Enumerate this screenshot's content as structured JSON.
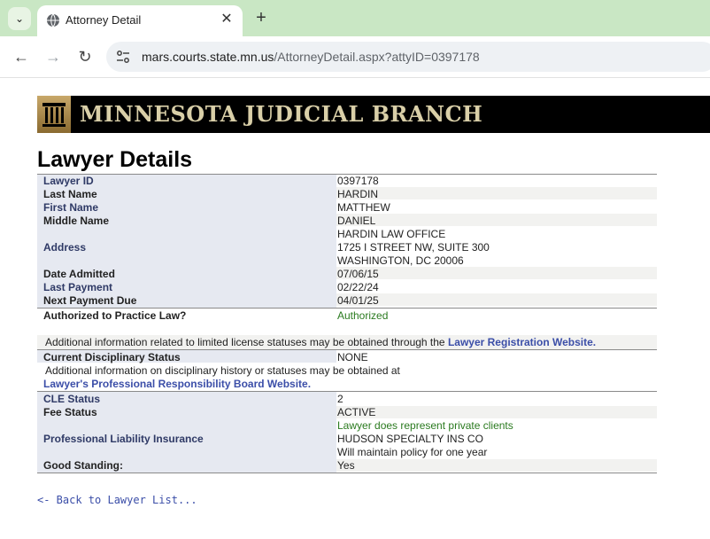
{
  "browser": {
    "tab_title": "Attorney Detail",
    "url_host": "mars.courts.state.mn.us",
    "url_path": "/AttorneyDetail.aspx?attyID=0397178"
  },
  "banner": {
    "title": "MINNESOTA JUDICIAL BRANCH"
  },
  "page_title": "Lawyer Details",
  "details": {
    "lawyer_id_label": "Lawyer ID",
    "lawyer_id": "0397178",
    "last_name_label": "Last Name",
    "last_name": "HARDIN",
    "first_name_label": "First Name",
    "first_name": "MATTHEW",
    "middle_name_label": "Middle Name",
    "middle_name": "DANIEL",
    "address_label": "Address",
    "address_line1": "HARDIN LAW OFFICE",
    "address_line2": "1725 I STREET NW, SUITE 300",
    "address_line3": "WASHINGTON, DC  20006",
    "date_admitted_label": "Date Admitted",
    "date_admitted": "07/06/15",
    "last_payment_label": "Last Payment",
    "last_payment": "02/22/24",
    "next_payment_label": "Next Payment Due",
    "next_payment": "04/01/25",
    "authorized_label": "Authorized to Practice Law?",
    "authorized": "Authorized",
    "license_note": "Additional information related to limited license statuses may be obtained through the",
    "license_link": "Lawyer Registration Website.",
    "disciplinary_label": "Current Disciplinary Status",
    "disciplinary": "NONE",
    "disciplinary_note": "Additional information on disciplinary history or statuses may be obtained at",
    "disciplinary_link": "Lawyer's Professional Responsibility Board Website.",
    "cle_label": "CLE Status",
    "cle": "2",
    "fee_label": "Fee Status",
    "fee": "ACTIVE",
    "insurance_label": "Professional Liability Insurance",
    "insurance_line1": "Lawyer does represent private clients",
    "insurance_line2": "HUDSON SPECIALTY INS CO",
    "insurance_line3": "Will maintain policy for one year",
    "good_standing_label": "Good Standing:",
    "good_standing": "Yes"
  },
  "back_link": "<- Back to Lawyer List..."
}
